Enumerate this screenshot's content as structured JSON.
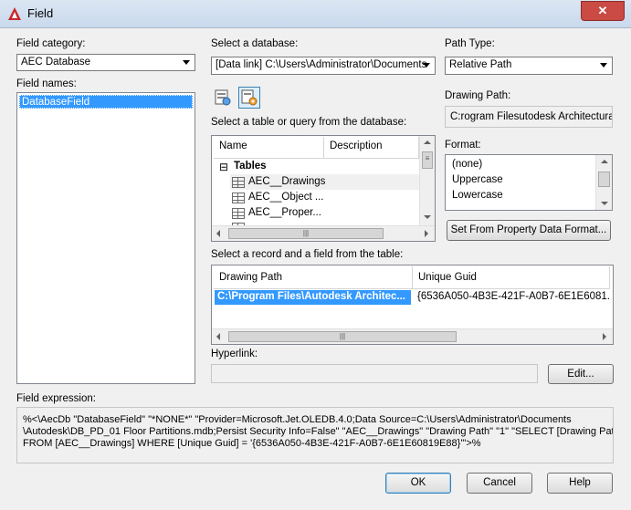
{
  "window": {
    "title": "Field",
    "close_label": "✕"
  },
  "field_category": {
    "label": "Field category:",
    "value": "AEC Database"
  },
  "field_names": {
    "label": "Field names:",
    "items": [
      "DatabaseField"
    ]
  },
  "database": {
    "label": "Select a database:",
    "value": "[Data link] C:\\Users\\Administrator\\Documents"
  },
  "path_type": {
    "label": "Path Type:",
    "value": "Relative Path"
  },
  "drawing_path": {
    "label": "Drawing Path:",
    "value": "C:rogram Filesutodesk Architectural"
  },
  "table_query": {
    "label": "Select a table or query from the database:",
    "columns": [
      "Name",
      "Description"
    ],
    "group": "Tables",
    "group_toggle": "⊟",
    "items": [
      "AEC__Drawings",
      "AEC__Object ...",
      "AEC__Proper..."
    ]
  },
  "format": {
    "label": "Format:",
    "options": [
      "(none)",
      "Uppercase",
      "Lowercase"
    ]
  },
  "set_from_property_button": "Set From Property Data Format...",
  "record": {
    "label": "Select a record and a field from the table:",
    "columns": [
      "Drawing Path",
      "Unique Guid"
    ],
    "row": [
      "C:\\Program Files\\Autodesk Architec...",
      "{6536A050-4B3E-421F-A0B7-6E1E6081..."
    ]
  },
  "hyperlink": {
    "label": "Hyperlink:",
    "value": "",
    "edit_button": "Edit..."
  },
  "field_expression": {
    "label": "Field expression:",
    "lines": [
      "%<\\AecDb \"DatabaseField\" \"*NONE*\" \"Provider=Microsoft.Jet.OLEDB.4.0;Data Source=C:\\Users\\Administrator\\Documents",
      "\\Autodesk\\DB_PD_01 Floor Partitions.mdb;Persist Security Info=False\" \"AEC__Drawings\" \"Drawing Path\" \"1\" \"SELECT [Drawing Path]",
      "FROM [AEC__Drawings] WHERE [Unique Guid] = '{6536A050-4B3E-421F-A0B7-6E1E60819E88}'\">%"
    ]
  },
  "buttons": {
    "ok": "OK",
    "cancel": "Cancel",
    "help": "Help"
  },
  "colors": {
    "accent": "#3399ff",
    "title_bar": "#c9d9ec",
    "close": "#c94b44"
  }
}
